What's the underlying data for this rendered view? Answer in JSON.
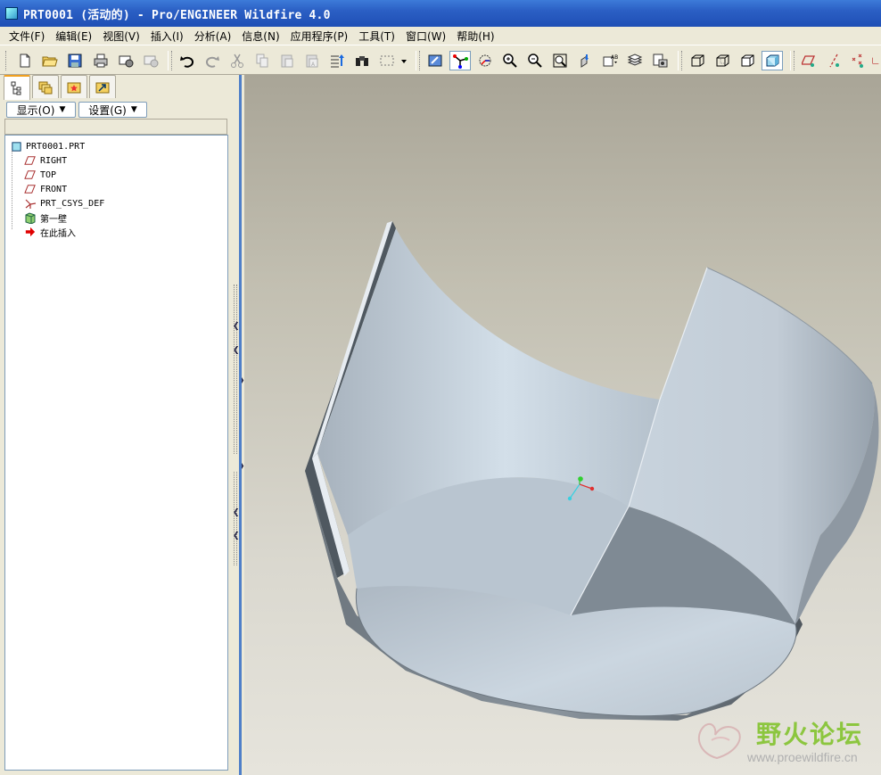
{
  "window": {
    "title": "PRT0001 (活动的) - Pro/ENGINEER Wildfire 4.0"
  },
  "menu": [
    "文件(F)",
    "编辑(E)",
    "视图(V)",
    "插入(I)",
    "分析(A)",
    "信息(N)",
    "应用程序(P)",
    "工具(T)",
    "窗口(W)",
    "帮助(H)"
  ],
  "toolbar": {
    "buttons": [
      "new-icon",
      "open-icon",
      "save-icon",
      "print-icon",
      "email-icon",
      "email-open-icon",
      "undo-icon",
      "redo-icon",
      "cut-icon",
      "copy-icon",
      "paste-icon",
      "paste-special-icon",
      "regenerate-icon",
      "find-icon",
      "select-box-icon",
      "repaint-icon",
      "spin-center-icon",
      "orient-icon",
      "zoom-in-icon",
      "zoom-out-icon",
      "refit-icon",
      "reorient-icon",
      "saved-views-icon",
      "layers-icon",
      "view-manager-icon",
      "wireframe-icon",
      "hidden-line-icon",
      "no-hidden-icon",
      "shading-icon",
      "datum-planes-icon",
      "datum-axes-icon",
      "datum-points-icon",
      "csys-icon"
    ]
  },
  "panel": {
    "show_label": "显示(O)",
    "settings_label": "设置(G)",
    "tree": [
      {
        "label": "PRT0001.PRT",
        "icon": "part-icon"
      },
      {
        "label": "RIGHT",
        "icon": "datum-plane-icon"
      },
      {
        "label": "TOP",
        "icon": "datum-plane-icon"
      },
      {
        "label": "FRONT",
        "icon": "datum-plane-icon"
      },
      {
        "label": "PRT_CSYS_DEF",
        "icon": "coordinate-system-icon"
      },
      {
        "label": "第一壁",
        "icon": "wall-feature-icon"
      },
      {
        "label": "在此插入",
        "icon": "insert-here-arrow-icon"
      }
    ]
  },
  "watermark": {
    "text_cn": "野火论坛",
    "url": "www.proewildfire.cn"
  },
  "colors": {
    "titlebar": "#2b5fc4",
    "surface": "#c9d4de",
    "insert_arrow": "#e00000"
  }
}
